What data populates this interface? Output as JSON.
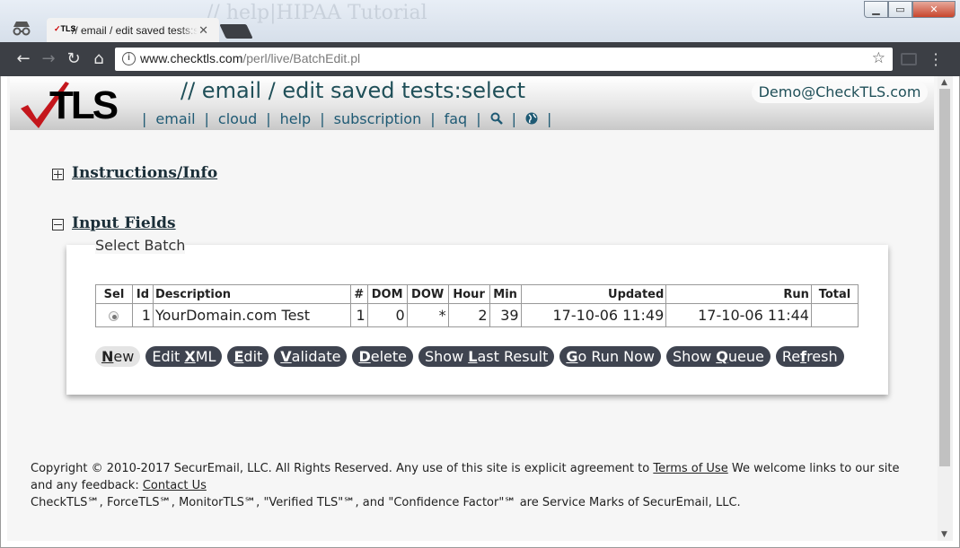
{
  "browser": {
    "background_title": "// help|HIPAA Tutorial",
    "tab_title": "// email / edit saved tests:select",
    "url_host": "www.checktls.com",
    "url_path": "/perl/live/BatchEdit.pl"
  },
  "header": {
    "logo_text": "TLS",
    "page_title": "// email / edit saved tests:select",
    "account": "Demo@CheckTLS.com",
    "nav": [
      {
        "label": "email"
      },
      {
        "label": "cloud"
      },
      {
        "label": "help"
      },
      {
        "label": "subscription"
      },
      {
        "label": "faq"
      }
    ],
    "separator": "|"
  },
  "sections": {
    "instructions": "Instructions/Info",
    "input_fields": "Input Fields"
  },
  "panel": {
    "legend": "Select Batch",
    "columns": [
      "Sel",
      "Id",
      "Description",
      "#",
      "DOM",
      "DOW",
      "Hour",
      "Min",
      "Updated",
      "Run",
      "Total"
    ],
    "rows": [
      {
        "id": "1",
        "description": "YourDomain.com Test",
        "count": "1",
        "dom": "0",
        "dow": "*",
        "hour": "2",
        "min": "39",
        "updated": "17-10-06 11:49",
        "run": "17-10-06 11:44",
        "total": ""
      }
    ],
    "buttons": [
      {
        "pre": "",
        "key": "N",
        "post": "ew"
      },
      {
        "pre": "Edit ",
        "key": "X",
        "post": "ML"
      },
      {
        "pre": "",
        "key": "E",
        "post": "dit"
      },
      {
        "pre": "",
        "key": "V",
        "post": "alidate"
      },
      {
        "pre": "",
        "key": "D",
        "post": "elete"
      },
      {
        "pre": "Show ",
        "key": "L",
        "post": "ast Result"
      },
      {
        "pre": "",
        "key": "G",
        "post": "o Run Now"
      },
      {
        "pre": "Show ",
        "key": "Q",
        "post": "ueue"
      },
      {
        "pre": "Re",
        "key": "f",
        "post": "resh"
      }
    ]
  },
  "footer": {
    "line1_pre": "Copyright © 2010-2017 SecurEmail, LLC. All Rights Reserved. Any use of this site is explicit agreement to ",
    "terms_link": "Terms of Use",
    "line1_post": " We welcome links to our site and any feedback: ",
    "contact_link": "Contact Us",
    "line2": "CheckTLS℠, ForceTLS℠, MonitorTLS℠, \"Verified TLS\"℠, and \"Confidence Factor\"℠ are Service Marks of SecurEmail, LLC."
  },
  "colors": {
    "title_teal": "#1f4f58",
    "button_dark": "#3f4450",
    "toolbar": "#3c3f45"
  }
}
